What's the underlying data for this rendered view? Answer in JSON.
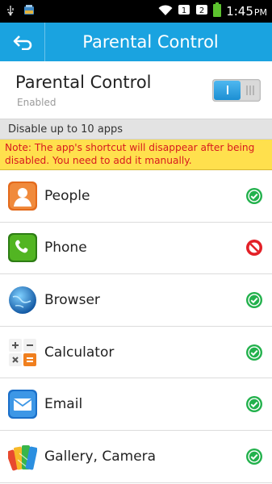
{
  "status_bar": {
    "time": "1:45",
    "ampm": "PM"
  },
  "app_bar": {
    "title": "Parental Control"
  },
  "header": {
    "title": "Parental Control",
    "subtitle": "Enabled",
    "toggle_on": true
  },
  "section_label": "Disable up to 10 apps",
  "note": "Note: The app's shortcut will disappear after being disabled. You need to add it manually.",
  "apps": [
    {
      "name": "People",
      "icon": "people-icon",
      "status": "allowed"
    },
    {
      "name": "Phone",
      "icon": "phone-icon",
      "status": "blocked"
    },
    {
      "name": "Browser",
      "icon": "browser-icon",
      "status": "allowed"
    },
    {
      "name": "Calculator",
      "icon": "calculator-icon",
      "status": "allowed"
    },
    {
      "name": "Email",
      "icon": "email-icon",
      "status": "allowed"
    },
    {
      "name": "Gallery, Camera",
      "icon": "gallery-icon",
      "status": "allowed"
    }
  ],
  "colors": {
    "accent": "#1aa3e0",
    "allowed": "#22b14c",
    "blocked": "#e32027",
    "note_bg": "#ffe04d",
    "note_text": "#d8191e"
  }
}
